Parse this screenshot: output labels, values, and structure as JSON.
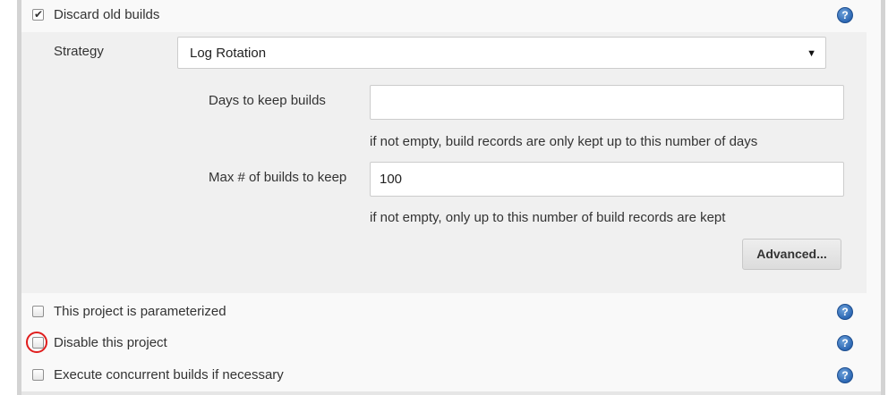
{
  "discard_old_builds": {
    "checked": true,
    "label": "Discard old builds",
    "help_icon": "help-icon",
    "strategy": {
      "label": "Strategy",
      "selected": "Log Rotation"
    },
    "days_to_keep": {
      "label": "Days to keep builds",
      "value": "",
      "hint": "if not empty, build records are only kept up to this number of days"
    },
    "max_builds": {
      "label": "Max # of builds to keep",
      "value": "100",
      "hint": "if not empty, only up to this number of build records are kept"
    },
    "advanced_button": "Advanced..."
  },
  "options": [
    {
      "label": "This project is parameterized",
      "checked": false,
      "help_icon": "help-icon"
    },
    {
      "label": "Disable this project",
      "checked": false,
      "help_icon": "help-icon",
      "highlighted": true,
      "highlight_color": "#e01e1e"
    },
    {
      "label": "Execute concurrent builds if necessary",
      "checked": false,
      "help_icon": "help-icon"
    }
  ],
  "colors": {
    "panel_bg": "#f9f9f9",
    "nested_bg": "#f0f0f0",
    "help_blue": "#2c67b3"
  }
}
